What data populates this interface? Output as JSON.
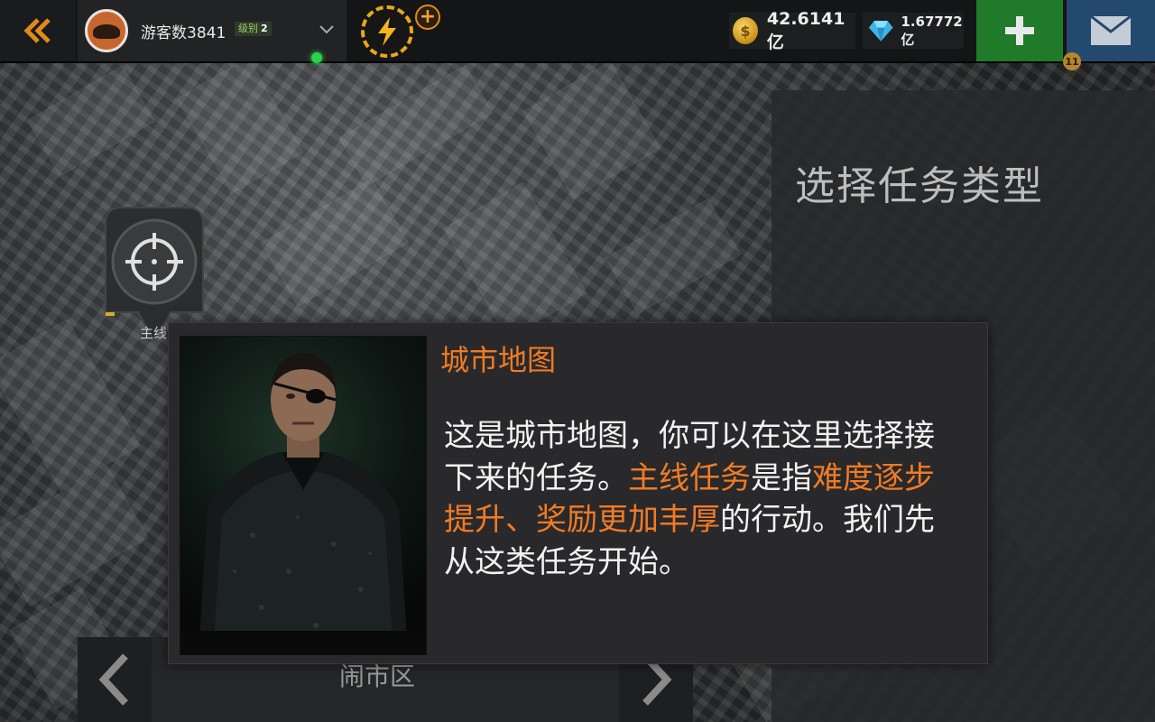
{
  "topbar": {
    "player_name": "游客数3841",
    "level_label": "级别",
    "level_value": "2",
    "coins": "42.6141亿",
    "gems": "1.67772亿",
    "mail_count": "11"
  },
  "panel": {
    "title": "选择任务类型"
  },
  "map": {
    "marker_label": "主线",
    "district_label": "闹市区"
  },
  "dialog": {
    "title": "城市地图",
    "body_part1": "这是城市地图，你可以在这里选择接下来的任务。",
    "body_highlight1": "主线任务",
    "body_part2": "是指",
    "body_highlight2": "难度逐步提升、奖励更加丰厚",
    "body_part3": "的行动。我们先从这类任务开始。"
  },
  "colors": {
    "accent_orange": "#f07b26",
    "add_green": "#1f7a2a",
    "mail_blue": "#24496e",
    "energy_gold": "#e8a81c"
  },
  "icons": [
    "double-chevron-left-icon",
    "avatar-icon",
    "chevron-down-icon",
    "lightning-icon",
    "plus-icon",
    "coin-icon",
    "diamond-icon",
    "mail-icon",
    "crosshair-icon",
    "chevron-left-icon",
    "chevron-right-icon"
  ]
}
